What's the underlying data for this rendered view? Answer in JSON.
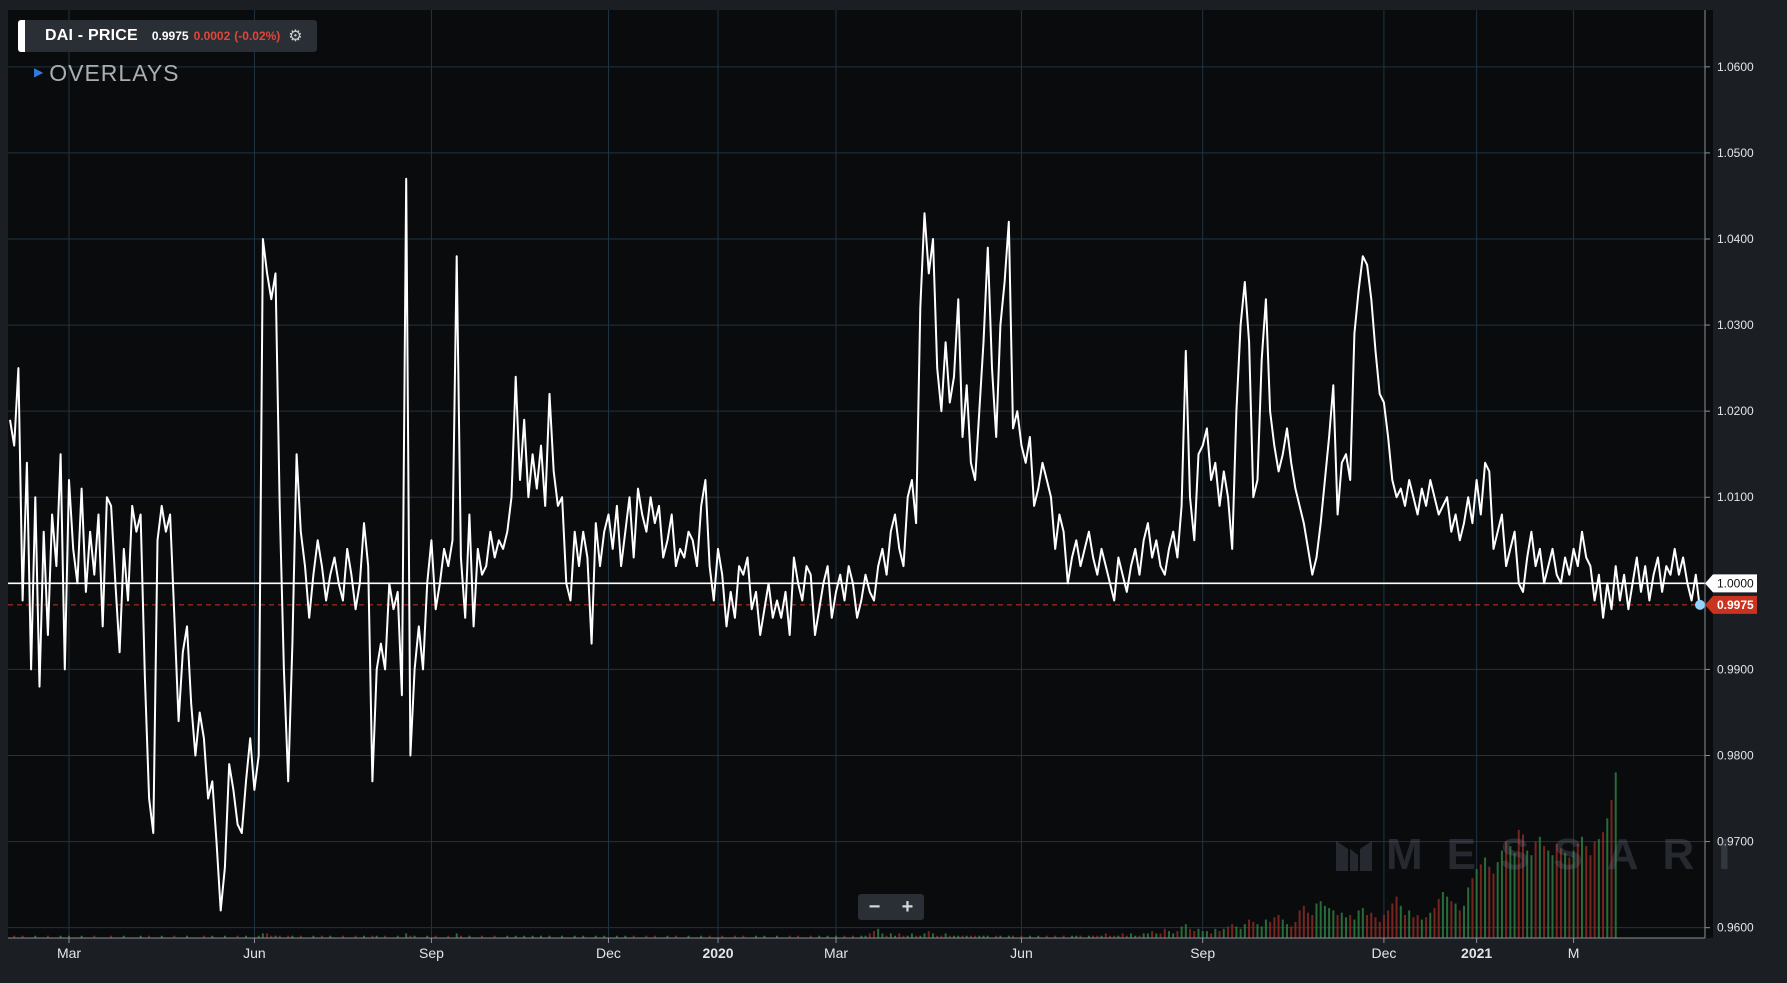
{
  "legend": {
    "title": "DAI - PRICE",
    "price": "0.9975",
    "change": "0.0002",
    "change_pct": "(-0.02%)"
  },
  "overlays": {
    "label": "OVERLAYS"
  },
  "zoom": {
    "minus": "−",
    "plus": "+"
  },
  "watermark": {
    "text": "MESSARI"
  },
  "chart_data": {
    "type": "line",
    "series": [
      {
        "values": [
          1.019,
          1.016,
          1.025,
          0.998,
          1.014,
          0.99,
          1.01,
          0.988,
          1.006,
          0.994,
          1.008,
          1.002,
          1.015,
          0.99,
          1.012,
          1.004,
          1.0,
          1.011,
          0.999,
          1.006,
          1.001,
          1.008,
          0.995,
          1.01,
          1.009,
          1.0,
          0.992,
          1.004,
          0.998,
          1.009,
          1.006,
          1.008,
          0.989,
          0.975,
          0.971,
          1.005,
          1.009,
          1.006,
          1.008,
          0.996,
          0.984,
          0.992,
          0.995,
          0.986,
          0.98,
          0.985,
          0.982,
          0.975,
          0.977,
          0.97,
          0.962,
          0.967,
          0.979,
          0.976,
          0.972,
          0.971,
          0.977,
          0.982,
          0.976,
          0.98,
          1.04,
          1.036,
          1.033,
          1.036,
          1.009,
          0.99,
          0.977,
          0.993,
          1.015,
          1.006,
          1.002,
          0.996,
          1.001,
          1.005,
          1.002,
          0.998,
          1.001,
          1.003,
          1.0,
          0.998,
          1.004,
          1.001,
          0.997,
          1.0,
          1.007,
          1.002,
          0.977,
          0.99,
          0.993,
          0.99,
          1.0,
          0.997,
          0.999,
          0.987,
          1.047,
          0.98,
          0.99,
          0.995,
          0.99,
          1.0,
          1.005,
          0.997,
          1.0,
          1.004,
          1.002,
          1.005,
          1.038,
          1.003,
          0.996,
          1.008,
          0.995,
          1.004,
          1.001,
          1.002,
          1.006,
          1.003,
          1.005,
          1.004,
          1.006,
          1.01,
          1.024,
          1.012,
          1.019,
          1.01,
          1.015,
          1.011,
          1.016,
          1.009,
          1.022,
          1.013,
          1.009,
          1.01,
          1.0,
          0.998,
          1.006,
          1.002,
          1.006,
          1.003,
          0.993,
          1.007,
          1.002,
          1.006,
          1.008,
          1.004,
          1.009,
          1.002,
          1.006,
          1.01,
          1.003,
          1.011,
          1.008,
          1.006,
          1.01,
          1.007,
          1.009,
          1.003,
          1.005,
          1.008,
          1.002,
          1.004,
          1.003,
          1.006,
          1.005,
          1.002,
          1.009,
          1.012,
          1.002,
          0.998,
          1.004,
          1.001,
          0.995,
          0.999,
          0.996,
          1.002,
          1.001,
          1.003,
          0.997,
          0.999,
          0.994,
          0.997,
          1.0,
          0.996,
          0.998,
          0.996,
          0.999,
          0.994,
          1.003,
          1.0,
          0.998,
          1.002,
          1.001,
          0.994,
          0.997,
          1.0,
          1.002,
          0.996,
          0.999,
          1.001,
          0.998,
          1.002,
          1.0,
          0.996,
          0.998,
          1.001,
          0.999,
          0.998,
          1.002,
          1.004,
          1.001,
          1.006,
          1.008,
          1.004,
          1.002,
          1.01,
          1.012,
          1.007,
          1.032,
          1.043,
          1.036,
          1.04,
          1.025,
          1.02,
          1.028,
          1.021,
          1.024,
          1.033,
          1.017,
          1.023,
          1.014,
          1.012,
          1.02,
          1.028,
          1.039,
          1.025,
          1.017,
          1.03,
          1.035,
          1.042,
          1.018,
          1.02,
          1.016,
          1.014,
          1.017,
          1.009,
          1.011,
          1.014,
          1.012,
          1.01,
          1.004,
          1.008,
          1.006,
          1.0,
          1.003,
          1.005,
          1.002,
          1.004,
          1.006,
          1.003,
          1.001,
          1.004,
          1.002,
          1.0,
          0.998,
          1.003,
          1.001,
          0.999,
          1.002,
          1.004,
          1.001,
          1.005,
          1.007,
          1.003,
          1.005,
          1.002,
          1.001,
          1.004,
          1.006,
          1.003,
          1.009,
          1.027,
          1.01,
          1.005,
          1.015,
          1.016,
          1.018,
          1.012,
          1.014,
          1.009,
          1.013,
          1.01,
          1.004,
          1.02,
          1.03,
          1.035,
          1.028,
          1.01,
          1.012,
          1.026,
          1.033,
          1.02,
          1.016,
          1.013,
          1.015,
          1.018,
          1.014,
          1.011,
          1.009,
          1.007,
          1.004,
          1.001,
          1.003,
          1.007,
          1.012,
          1.017,
          1.023,
          1.008,
          1.014,
          1.015,
          1.012,
          1.029,
          1.034,
          1.038,
          1.037,
          1.033,
          1.027,
          1.022,
          1.021,
          1.017,
          1.012,
          1.01,
          1.011,
          1.009,
          1.012,
          1.01,
          1.008,
          1.011,
          1.009,
          1.012,
          1.01,
          1.008,
          1.009,
          1.01,
          1.006,
          1.008,
          1.005,
          1.007,
          1.01,
          1.007,
          1.012,
          1.008,
          1.014,
          1.013,
          1.004,
          1.006,
          1.008,
          1.002,
          1.004,
          1.006,
          1.0,
          0.999,
          1.003,
          1.006,
          1.002,
          1.004,
          1.0,
          1.002,
          1.004,
          1.001,
          1.0,
          1.003,
          1.001,
          1.004,
          1.002,
          1.006,
          1.003,
          1.002,
          0.998,
          1.001,
          0.996,
          1.0,
          0.997,
          1.002,
          0.998,
          1.001,
          0.997,
          1.0,
          1.003,
          0.999,
          1.002,
          0.998,
          1.001,
          1.003,
          0.999,
          1.002,
          1.001,
          1.004,
          1.001,
          1.003,
          1.0,
          0.998,
          1.001,
          0.997
        ]
      }
    ],
    "x_tick_labels": [
      {
        "label": "Mar",
        "index": 14,
        "bold": false
      },
      {
        "label": "Jun",
        "index": 58,
        "bold": false
      },
      {
        "label": "Sep",
        "index": 100,
        "bold": false
      },
      {
        "label": "Dec",
        "index": 142,
        "bold": false
      },
      {
        "label": "2020",
        "index": 168,
        "bold": true
      },
      {
        "label": "Mar",
        "index": 196,
        "bold": false
      },
      {
        "label": "Jun",
        "index": 240,
        "bold": false
      },
      {
        "label": "Sep",
        "index": 283,
        "bold": false
      },
      {
        "label": "Dec",
        "index": 326,
        "bold": false
      },
      {
        "label": "2021",
        "index": 348,
        "bold": true
      },
      {
        "label": "M",
        "index": 371,
        "bold": false
      }
    ],
    "y_tick_labels": [
      "0.9600",
      "0.9700",
      "0.9800",
      "0.9900",
      "1.0000",
      "1.0100",
      "1.0200",
      "1.0300",
      "1.0400",
      "1.0500",
      "1.0600"
    ],
    "ylim": [
      0.9588,
      1.0666
    ],
    "reference_line": {
      "value": 1.0,
      "label": "1.0000"
    },
    "last_price": {
      "value": 0.9975,
      "label": "0.9975"
    },
    "volume_bars": [
      0.0,
      0.01,
      0.0,
      0.01,
      0.0,
      0.0,
      0.01,
      0.0,
      0.0,
      0.01,
      0.0,
      0.0,
      0.01,
      0.0,
      0.01,
      0.0,
      0.0,
      0.01,
      0.0,
      0.0,
      0.01,
      0.0,
      0.0,
      0.0,
      0.01,
      0.0,
      0.0,
      0.01,
      0.0,
      0.0,
      0.0,
      0.01,
      0.0,
      0.01,
      0.0,
      0.0,
      0.01,
      0.0,
      0.0,
      0.01,
      0.0,
      0.0,
      0.01,
      0.0,
      0.0,
      0.0,
      0.01,
      0.0,
      0.01,
      0.0,
      0.0,
      0.01,
      0.0,
      0.0,
      0.01,
      0.0,
      0.01,
      0.0,
      0.0,
      0.01,
      0.02,
      0.02,
      0.01,
      0.01,
      0.01,
      0.0,
      0.01,
      0.01,
      0.0,
      0.01,
      0.0,
      0.0,
      0.01,
      0.0,
      0.01,
      0.0,
      0.01,
      0.0,
      0.0,
      0.01,
      0.0,
      0.0,
      0.01,
      0.0,
      0.01,
      0.0,
      0.01,
      0.01,
      0.0,
      0.01,
      0.0,
      0.0,
      0.01,
      0.0,
      0.02,
      0.01,
      0.01,
      0.0,
      0.0,
      0.01,
      0.0,
      0.01,
      0.0,
      0.0,
      0.01,
      0.0,
      0.02,
      0.01,
      0.0,
      0.01,
      0.0,
      0.0,
      0.01,
      0.0,
      0.0,
      0.01,
      0.0,
      0.0,
      0.01,
      0.0,
      0.01,
      0.0,
      0.01,
      0.0,
      0.01,
      0.0,
      0.01,
      0.0,
      0.01,
      0.0,
      0.0,
      0.01,
      0.0,
      0.0,
      0.01,
      0.0,
      0.01,
      0.0,
      0.0,
      0.01,
      0.0,
      0.01,
      0.0,
      0.0,
      0.01,
      0.0,
      0.01,
      0.0,
      0.01,
      0.0,
      0.0,
      0.01,
      0.0,
      0.01,
      0.0,
      0.0,
      0.01,
      0.0,
      0.01,
      0.0,
      0.0,
      0.01,
      0.0,
      0.0,
      0.01,
      0.0,
      0.01,
      0.0,
      0.0,
      0.01,
      0.0,
      0.0,
      0.01,
      0.0,
      0.01,
      0.0,
      0.0,
      0.01,
      0.0,
      0.01,
      0.0,
      0.0,
      0.01,
      0.0,
      0.0,
      0.01,
      0.0,
      0.01,
      0.0,
      0.0,
      0.01,
      0.0,
      0.01,
      0.0,
      0.01,
      0.0,
      0.01,
      0.0,
      0.01,
      0.0,
      0.01,
      0.0,
      0.01,
      0.01,
      0.02,
      0.03,
      0.04,
      0.02,
      0.01,
      0.02,
      0.01,
      0.02,
      0.01,
      0.01,
      0.02,
      0.01,
      0.01,
      0.02,
      0.03,
      0.02,
      0.01,
      0.01,
      0.02,
      0.01,
      0.01,
      0.01,
      0.01,
      0.01,
      0.01,
      0.01,
      0.01,
      0.01,
      0.01,
      0.0,
      0.01,
      0.01,
      0.0,
      0.01,
      0.01,
      0.0,
      0.01,
      0.0,
      0.01,
      0.0,
      0.01,
      0.0,
      0.01,
      0.0,
      0.01,
      0.0,
      0.01,
      0.0,
      0.01,
      0.01,
      0.01,
      0.0,
      0.01,
      0.01,
      0.01,
      0.01,
      0.02,
      0.01,
      0.01,
      0.01,
      0.02,
      0.01,
      0.02,
      0.01,
      0.01,
      0.02,
      0.02,
      0.03,
      0.02,
      0.02,
      0.04,
      0.03,
      0.02,
      0.03,
      0.05,
      0.06,
      0.04,
      0.03,
      0.04,
      0.03,
      0.03,
      0.02,
      0.04,
      0.03,
      0.04,
      0.05,
      0.06,
      0.05,
      0.04,
      0.06,
      0.08,
      0.07,
      0.06,
      0.05,
      0.08,
      0.07,
      0.09,
      0.1,
      0.08,
      0.06,
      0.05,
      0.07,
      0.12,
      0.14,
      0.11,
      0.1,
      0.15,
      0.16,
      0.14,
      0.13,
      0.12,
      0.1,
      0.11,
      0.09,
      0.1,
      0.08,
      0.12,
      0.13,
      0.1,
      0.11,
      0.09,
      0.07,
      0.1,
      0.12,
      0.15,
      0.18,
      0.14,
      0.1,
      0.12,
      0.09,
      0.1,
      0.08,
      0.09,
      0.11,
      0.13,
      0.17,
      0.2,
      0.18,
      0.16,
      0.15,
      0.12,
      0.14,
      0.22,
      0.26,
      0.3,
      0.32,
      0.35,
      0.31,
      0.28,
      0.33,
      0.38,
      0.42,
      0.4,
      0.37,
      0.47,
      0.45,
      0.38,
      0.36,
      0.42,
      0.44,
      0.4,
      0.38,
      0.36,
      0.41,
      0.39,
      0.37,
      0.35,
      0.38,
      0.41,
      0.44,
      0.4,
      0.36,
      0.42,
      0.43,
      0.46,
      0.52,
      0.6,
      0.72
    ],
    "colors": {
      "background": "#0a0b0d",
      "frame": "#1b1e23",
      "grid": "#1f3443",
      "line": "#ffffff",
      "last_price": "#c9331f",
      "volume_up": "#2e7d42",
      "volume_down": "#8a2a23"
    }
  }
}
